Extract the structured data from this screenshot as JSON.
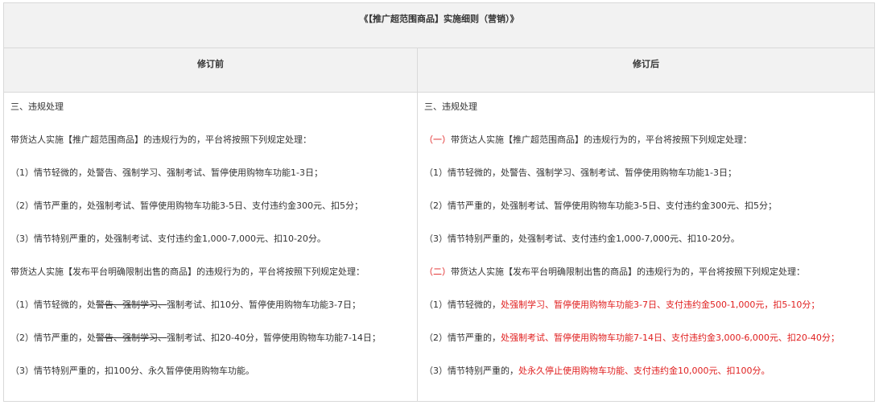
{
  "title": "《【推广超范围商品】实施细则（营销）》",
  "headers": {
    "before": "修订前",
    "after": "修订后"
  },
  "before": {
    "l1": "三、违规处理",
    "l2": "带货达人实施【推广超范围商品】的违规行为的，平台将按照下列规定处理：",
    "l3": "（1）情节轻微的，处警告、强制学习、强制考试、暂停使用购物车功能1-3日；",
    "l4": "（2）情节严重的，处强制考试、暂停使用购物车功能3-5日、支付违约金300元、扣5分；",
    "l5": "（3）情节特别严重的，处强制考试、支付违约金1,000-7,000元、扣10-20分。",
    "l6": "带货达人实施【发布平台明确限制出售的商品】的违规行为的，平台将按照下列规定处理：",
    "l7": {
      "a": "（1）情节轻微的，处",
      "b": "警告、",
      "c": "强制学习、",
      "d": "强制考试、扣10分、暂停使用购物车功能3-7日；"
    },
    "l8": {
      "a": "（2）情节严重的，处",
      "b": "警告、强制学习、",
      "c": "强制考试、扣20-40分，暂停使用购物车功能7-14日；"
    },
    "l9": "（3）情节特别严重的，扣100分、永久暂停使用购物车功能。"
  },
  "after": {
    "l1": "三、违规处理",
    "l2": {
      "mark": "（一）",
      "rest": "带货达人实施【推广超范围商品】的违规行为的，平台将按照下列规定处理："
    },
    "l3": "（1）情节轻微的，处警告、强制学习、强制考试、暂停使用购物车功能1-3日；",
    "l4": "（2）情节严重的，处强制考试、暂停使用购物车功能3-5日、支付违约金300元、扣5分；",
    "l5": "（3）情节特别严重的，处强制考试、支付违约金1,000-7,000元、扣10-20分。",
    "l6": {
      "mark": "（二）",
      "rest": "带货达人实施【发布平台明确限制出售的商品】的违规行为的，平台将按照下列规定处理："
    },
    "l7": {
      "a": "（1）情节轻微的，",
      "b": "处强制学习、暂停使用购物车功能3-7日、支付违约金500-1,000元，扣5-10分；"
    },
    "l8": {
      "a": "（2）情节严重的，",
      "b": "处强制考试、暂停使用购物车功能7-14日、支付违约金3,000-6,000元、扣20-40分；"
    },
    "l9": {
      "a": "（3）情节特别严重的，",
      "b": "处永久停止使用购物车功能、支付违约金10,000元、扣100分。"
    }
  },
  "colors": {
    "highlight": "#e02020",
    "header_bg": "#f2f2f2",
    "border": "#d9d9d9"
  }
}
